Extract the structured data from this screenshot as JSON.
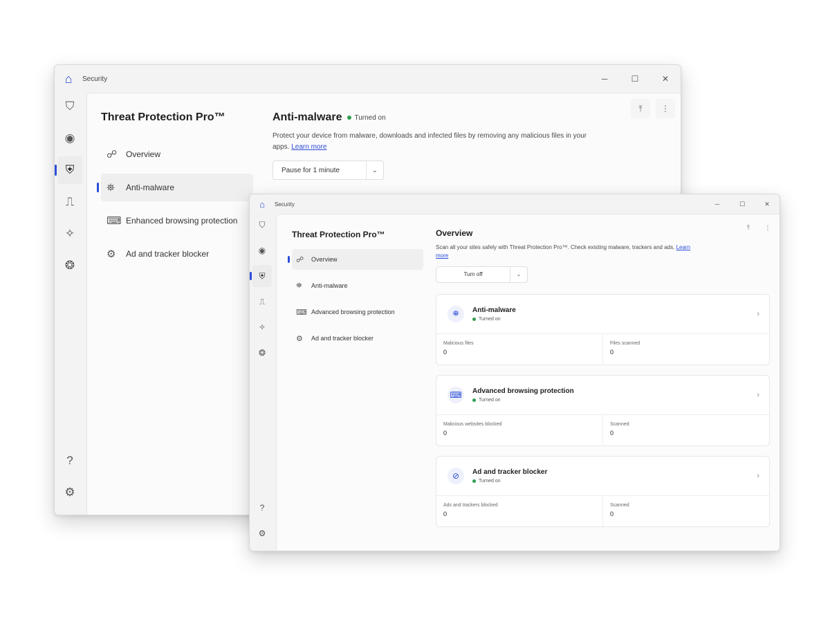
{
  "back_window": {
    "app_name": "Security",
    "controls": {
      "minimize": "─",
      "maximize": "☐",
      "close": "✕"
    },
    "rail": {
      "top": [
        {
          "name": "shield-icon",
          "glyph": "⛉"
        },
        {
          "name": "globe-icon",
          "glyph": "◉"
        },
        {
          "name": "protection-icon",
          "glyph": "⛨"
        },
        {
          "name": "devices-icon",
          "glyph": "⎍"
        },
        {
          "name": "apps-icon",
          "glyph": "✧"
        },
        {
          "name": "family-icon",
          "glyph": "❂"
        }
      ],
      "bottom": [
        {
          "name": "help-icon",
          "glyph": "?"
        },
        {
          "name": "settings-icon",
          "glyph": "⚙"
        }
      ]
    },
    "product_title": "Threat Protection Pro™",
    "nav": [
      {
        "label": "Overview",
        "icon": "☍"
      },
      {
        "label": "Anti-malware",
        "icon": "⛯"
      },
      {
        "label": "Enhanced browsing protection",
        "icon": "⌨"
      },
      {
        "label": "Ad and tracker blocker",
        "icon": "⚙"
      }
    ],
    "title": "Anti-malware",
    "status": "Turned on",
    "description": "Protect your device from malware, downloads and infected files by removing any malicious files in your apps.",
    "link": "Learn more",
    "dropdown": "Pause for 1 minute",
    "actions": {
      "share": "⤒",
      "more": "⋮"
    }
  },
  "front_window": {
    "app_name": "Security",
    "controls": {
      "minimize": "─",
      "maximize": "☐",
      "close": "✕"
    },
    "rail": {
      "top": [
        {
          "name": "shield-icon",
          "glyph": "⛉"
        },
        {
          "name": "globe-icon",
          "glyph": "◉"
        },
        {
          "name": "protection-icon",
          "glyph": "⛨"
        },
        {
          "name": "devices-icon",
          "glyph": "⎍"
        },
        {
          "name": "apps-icon",
          "glyph": "✧"
        },
        {
          "name": "family-icon",
          "glyph": "❂"
        }
      ],
      "bottom": [
        {
          "name": "help-icon",
          "glyph": "?"
        },
        {
          "name": "settings-icon",
          "glyph": "⚙"
        }
      ]
    },
    "product_title": "Threat Protection Pro™",
    "nav": [
      {
        "label": "Overview",
        "icon": "☍"
      },
      {
        "label": "Anti-malware",
        "icon": "⛯"
      },
      {
        "label": "Advanced browsing protection",
        "icon": "⌨"
      },
      {
        "label": "Ad and tracker blocker",
        "icon": "⚙"
      }
    ],
    "title": "Overview",
    "description": "Scan all your sites safely with Threat Protection Pro™. Check existing malware, trackers and ads.",
    "link": "Learn more",
    "dropdown": "Turn off",
    "actions": {
      "share": "⤒",
      "more": "⋮"
    },
    "cards": [
      {
        "title": "Anti-malware",
        "status": "Turned on",
        "icon": "⛯",
        "stats": [
          {
            "label": "Malicious files",
            "value": "0"
          },
          {
            "label": "Files scanned",
            "value": "0"
          }
        ]
      },
      {
        "title": "Advanced browsing protection",
        "status": "Turned on",
        "icon": "⌨",
        "stats": [
          {
            "label": "Malicious websites blocked",
            "value": "0"
          },
          {
            "label": "Scanned",
            "value": "0"
          }
        ]
      },
      {
        "title": "Ad and tracker blocker",
        "status": "Turned on",
        "icon": "⊘",
        "stats": [
          {
            "label": "Ads and trackers blocked",
            "value": "0"
          },
          {
            "label": "Scanned",
            "value": "0"
          }
        ]
      }
    ]
  },
  "colors": {
    "accent": "#2b4dd8",
    "status_on": "#2e9e4f",
    "window_bg": "#f3f3f3",
    "content_bg": "#fbfbfb"
  }
}
